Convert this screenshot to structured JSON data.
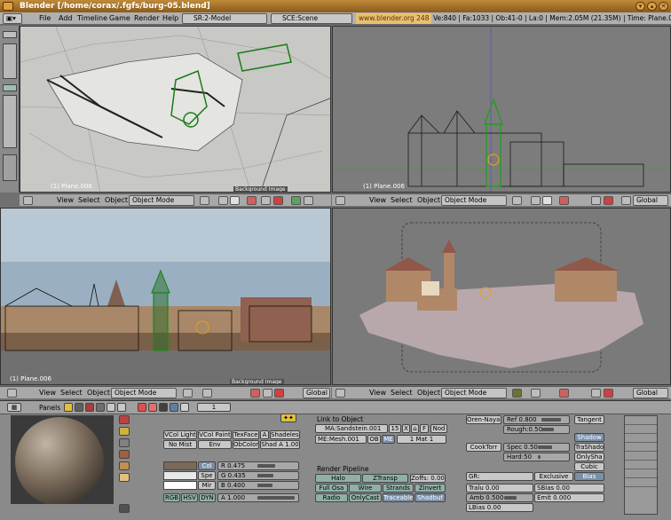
{
  "window": {
    "title": "Blender [/home/corax/.fgfs/burg-05.blend]"
  },
  "menu": {
    "items": [
      "File",
      "Add",
      "Timeline",
      "Game",
      "Render",
      "Help"
    ],
    "screen": "SR:2-Model",
    "scene": "SCE:Scene",
    "url": "www.blender.org 248",
    "stats": "Ve:840 | Fa:1033 | Ob:41-0 | La:0 | Mem:2.05M (21.35M) | Time: Plane.006"
  },
  "viewport": {
    "object_label": "(1) Plane.006",
    "background_image_tag": "Background Image",
    "view": "View",
    "select": "Select",
    "object": "Object",
    "mode": "Object Mode",
    "orientation": "Global"
  },
  "buttons_window": {
    "panels": "Panels",
    "frame": "1",
    "shading_buttons": [
      "VCol Light",
      "VCol Paint",
      "TexFace",
      "A",
      "Shadeless",
      "No Mist",
      "Env",
      "ObColor",
      "Shad A 1.00"
    ],
    "color_tabs": [
      "Col",
      "Spe",
      "Mir"
    ],
    "rgb": [
      {
        "label": "R 0.475",
        "value": 0.475
      },
      {
        "label": "G 0.435",
        "value": 0.435
      },
      {
        "label": "B 0.400",
        "value": 0.4
      }
    ],
    "color_modes": [
      "RGB",
      "HSV",
      "DYN"
    ],
    "alpha": {
      "label": "A 1.000",
      "value": 1.0
    },
    "link": {
      "title": "Link to Object",
      "material": "MA:Sandstein.001",
      "users": "15",
      "x": "X",
      "f": "F",
      "nod": "Nod",
      "mesh": "ME:Mesh.001",
      "ob": "OB",
      "me": "ME",
      "mat": "1 Mat 1"
    },
    "pipeline": {
      "title": "Render Pipeline",
      "buttons": [
        "Halo",
        "ZTransp",
        "Zoffs: 0.00",
        "Full Osa",
        "Wire",
        "Strands",
        "Zinvert",
        "Radio",
        "OnlyCast",
        "Traceable",
        "Shadbuf"
      ]
    },
    "shader": {
      "diffuse": "Oren-Nayar",
      "ref": {
        "label": "Ref  0.800",
        "value": 0.8
      },
      "rough": {
        "label": "Rough:0.50",
        "value": 0.5
      },
      "tangent": "Tangent",
      "specular": "CookTorr",
      "spec": {
        "label": "Spec 0.50",
        "value": 0.5
      },
      "hard": {
        "label": "Hard:50",
        "value": 0.1
      },
      "toggles": [
        "Shadow",
        "TraShado",
        "OnlySha",
        "Cubic",
        "Bias"
      ],
      "group": "GR:",
      "exclusive": "Exclusive",
      "tralu": "Tralu 0.00",
      "sbias": "SBias 0.00",
      "amb": {
        "label": "Amb 0.500",
        "value": 0.5
      },
      "emit": "Emit 0.000",
      "lbias": "LBias 0.00"
    }
  }
}
